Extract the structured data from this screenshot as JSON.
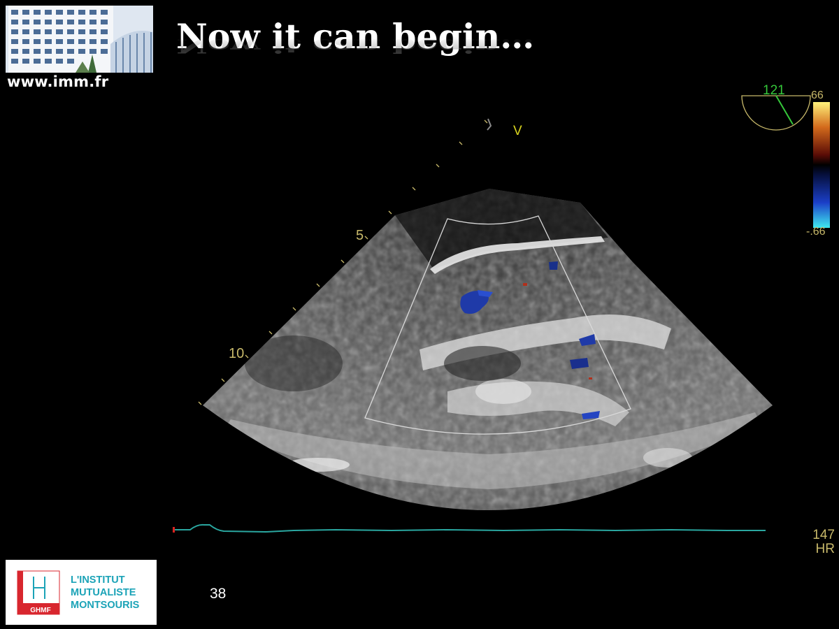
{
  "header": {
    "title": "Now it can begin…",
    "site_url": "www.imm.fr"
  },
  "echo_display": {
    "marker_v": "V",
    "depth_marks": [
      "5",
      "10"
    ],
    "angle_value": "121",
    "color_scale_top": "66",
    "color_scale_bottom": "-.66",
    "hr_value": "147",
    "hr_label": "HR",
    "colors": {
      "overlay_text": "#c8b96a",
      "ecg_trace": "#2aa7a0",
      "angle_needle": "#35c83a",
      "doppler_blue": "#1f3aa8",
      "doppler_red": "#b0301c"
    }
  },
  "footer": {
    "slide_number": "38",
    "logo": {
      "line1": "L'INSTITUT",
      "line2": "MUTUALISTE",
      "line3": "MONTSOURIS",
      "badge": "GHMF",
      "brand_color": "#1ba3b7",
      "badge_color": "#d8262e"
    }
  }
}
